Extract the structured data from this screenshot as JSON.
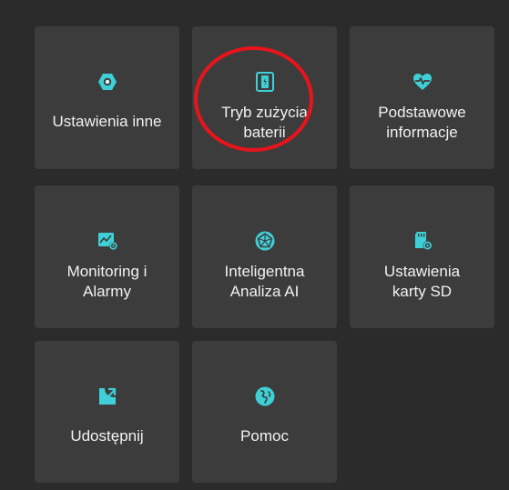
{
  "tiles": [
    {
      "label": "Ustawienia inne",
      "icon": "settings-hex-icon"
    },
    {
      "label": "Tryb zużycia\nbaterii",
      "icon": "battery-mode-icon"
    },
    {
      "label": "Podstawowe\ninformacje",
      "icon": "heart-pulse-icon"
    },
    {
      "label": "Monitoring i\nAlarmy",
      "icon": "monitoring-alarm-icon"
    },
    {
      "label": "Inteligentna\nAnaliza AI",
      "icon": "ai-analysis-icon"
    },
    {
      "label": "Ustawienia\nkarty SD",
      "icon": "sd-card-settings-icon"
    },
    {
      "label": "Udostępnij",
      "icon": "share-icon"
    },
    {
      "label": "Pomoc",
      "icon": "help-globe-icon"
    }
  ],
  "colors": {
    "background": "#2b2b2b",
    "tile": "#3c3c3c",
    "text": "#f2f2f2",
    "icon_accent": "#3ed0d6",
    "highlight_ring": "#e8141b"
  }
}
